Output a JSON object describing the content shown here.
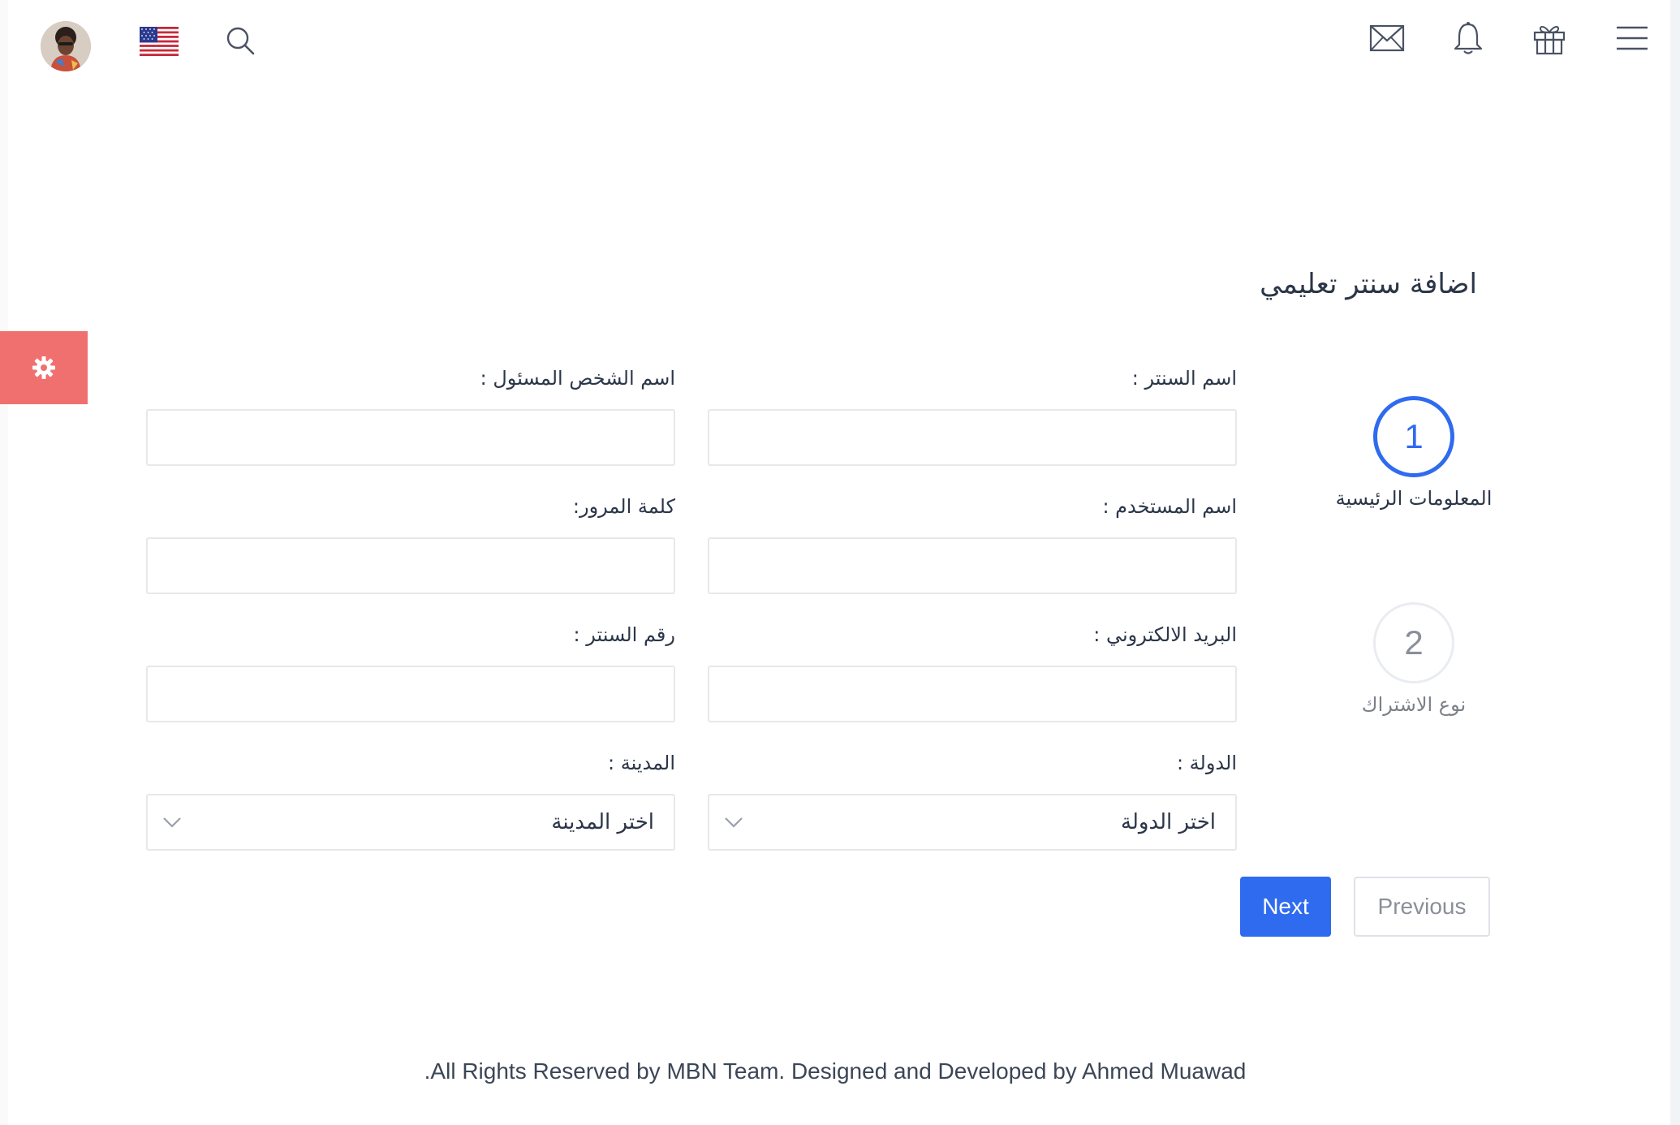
{
  "header": {
    "avatar": "user-avatar",
    "language_flag": "us-flag-icon",
    "search_icon": "search-icon",
    "mail_icon": "mail-icon",
    "notification_icon": "bell-icon",
    "gift_icon": "gift-icon",
    "menu_icon": "hamburger-menu-icon"
  },
  "settings": {
    "icon": "gear-icon",
    "color": "#f07070"
  },
  "page": {
    "title": "اضافة سنتر تعليمي"
  },
  "stepper": {
    "accent_color": "#2f6bef",
    "steps": [
      {
        "number": "1",
        "label": "المعلومات الرئيسية",
        "state": "active"
      },
      {
        "number": "2",
        "label": "نوع الاشتراك",
        "state": "inactive"
      }
    ]
  },
  "form": {
    "center_name": {
      "label": "اسم السنتر :",
      "value": ""
    },
    "responsible_person": {
      "label": "اسم الشخص المسئول :",
      "value": ""
    },
    "username": {
      "label": "اسم المستخدم :",
      "value": ""
    },
    "password": {
      "label": "كلمة المرور:",
      "value": ""
    },
    "email": {
      "label": "البريد الالكتروني :",
      "value": ""
    },
    "center_phone": {
      "label": "رقم السنتر :",
      "value": ""
    },
    "country": {
      "label": "الدولة :",
      "selected": "اختر الدولة"
    },
    "city": {
      "label": "المدينة :",
      "selected": "اختر المدينة"
    }
  },
  "actions": {
    "next_label": "Next",
    "previous_label": "Previous"
  },
  "footer": {
    "text": ".All Rights Reserved by MBN Team. Designed and Developed by Ahmed Muawad"
  }
}
